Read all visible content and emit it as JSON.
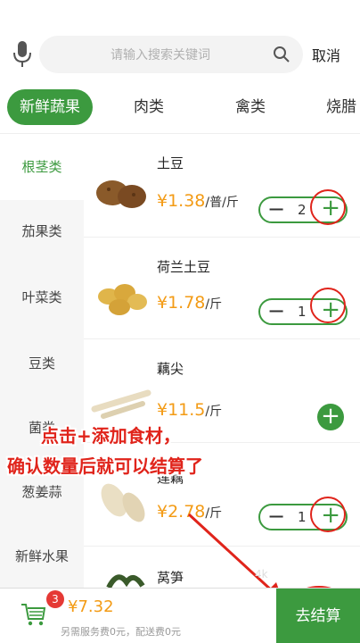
{
  "search": {
    "placeholder": "请输入搜索关键词",
    "cancel_label": "取消"
  },
  "tabs": [
    {
      "label": "新鲜蔬果",
      "active": true
    },
    {
      "label": "肉类",
      "active": false
    },
    {
      "label": "禽类",
      "active": false
    },
    {
      "label": "烧腊",
      "active": false
    }
  ],
  "sidebar": {
    "items": [
      {
        "label": "根茎类",
        "active": true
      },
      {
        "label": "茄果类",
        "active": false
      },
      {
        "label": "叶菜类",
        "active": false
      },
      {
        "label": "豆类",
        "active": false
      },
      {
        "label": "菌类",
        "active": false
      },
      {
        "label": "葱姜蒜",
        "active": false
      },
      {
        "label": "新鲜水果",
        "active": false
      }
    ]
  },
  "products": [
    {
      "name": "土豆",
      "price": "¥1.38",
      "unit": "/普/斤",
      "qty": "2",
      "control": "stepper"
    },
    {
      "name": "荷兰土豆",
      "price": "¥1.78",
      "unit": "/斤",
      "qty": "1",
      "control": "stepper"
    },
    {
      "name": "藕尖",
      "price": "¥11.5",
      "unit": "/斤",
      "qty": "",
      "control": "add"
    },
    {
      "name": "莲藕",
      "price": "¥2.78",
      "unit": "/斤",
      "qty": "1",
      "control": "stepper"
    },
    {
      "name": "莴笋",
      "price": "",
      "unit": "",
      "qty": "",
      "control": "none"
    }
  ],
  "annotation": {
    "line1": "点击+添加食材，",
    "line2": "确认数量后就可以结算了"
  },
  "cart": {
    "badge_count": "3",
    "total": "¥7.32",
    "fees": "另需服务费0元，配送费0元",
    "checkout_label": "去结算"
  },
  "watermark": "4k",
  "colors": {
    "accent": "#3c9a3f",
    "price": "#f39b15",
    "annotation": "#e0241b"
  }
}
